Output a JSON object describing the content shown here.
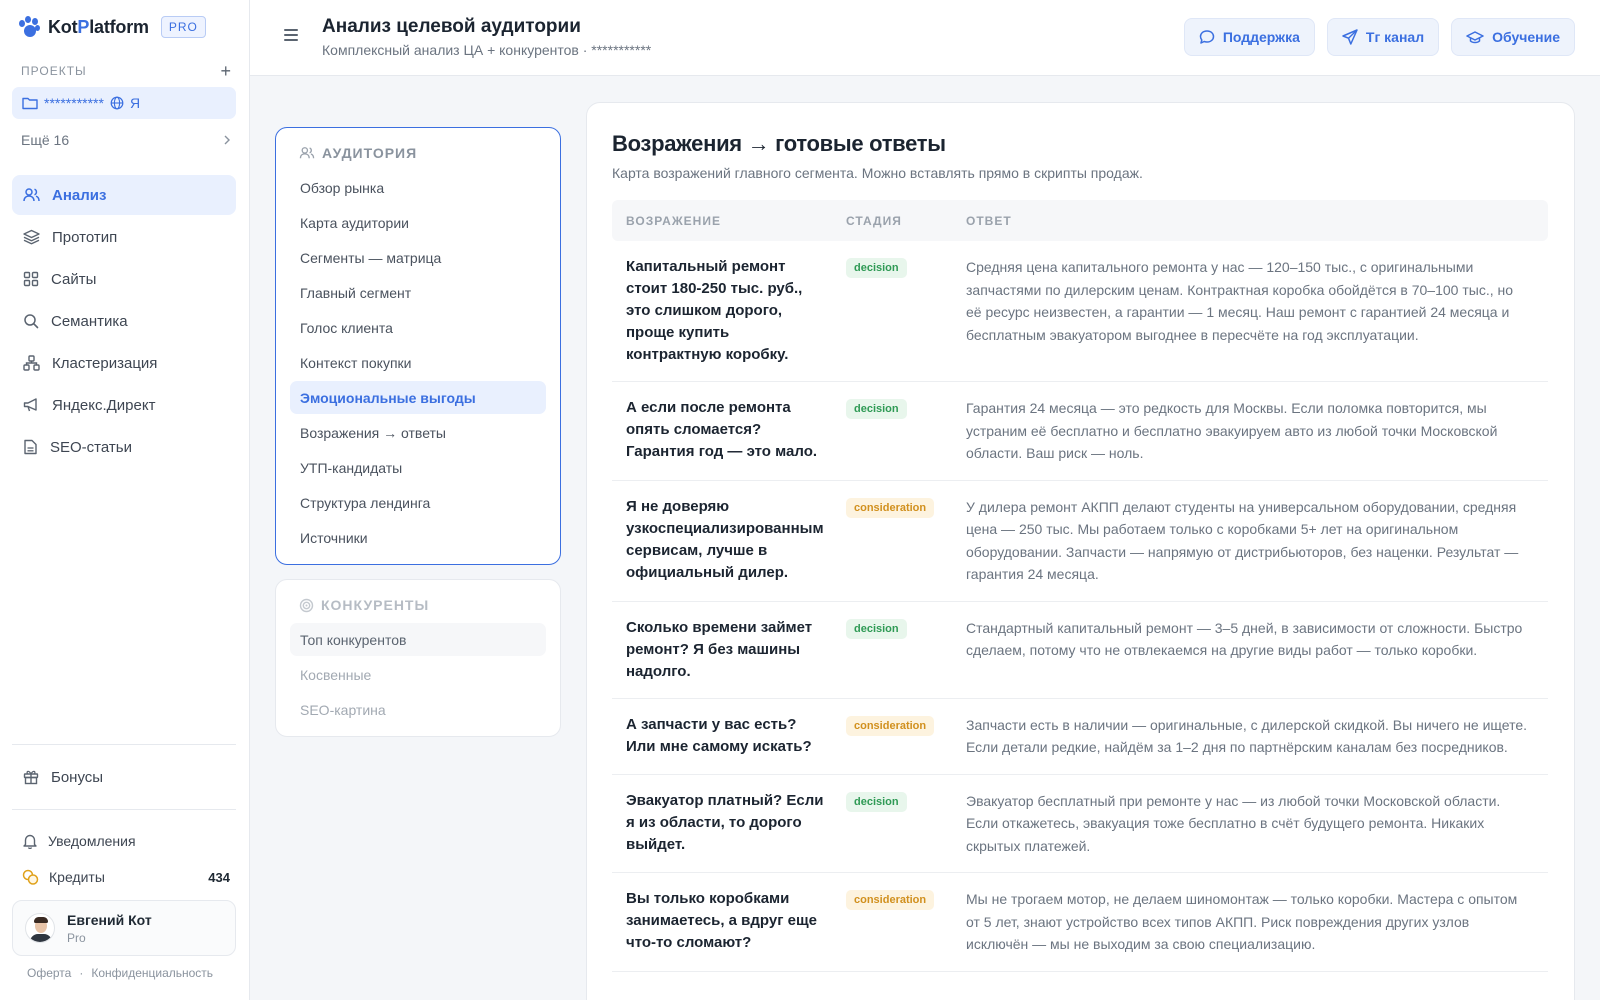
{
  "app": {
    "logo_prefix": "Kot",
    "logo_accent": "P",
    "logo_suffix": "latform",
    "plan_badge": "PRO"
  },
  "sidebar": {
    "projects_title": "ПРОЕКТЫ",
    "add_symbol": "+",
    "project": {
      "name": "***********",
      "owner": "Я"
    },
    "more_label": "Ещё 16",
    "nav": [
      {
        "label": "Анализ",
        "icon": "users-icon",
        "active": true
      },
      {
        "label": "Прототип",
        "icon": "layers-icon"
      },
      {
        "label": "Сайты",
        "icon": "grid-icon"
      },
      {
        "label": "Семантика",
        "icon": "search-icon"
      },
      {
        "label": "Кластеризация",
        "icon": "cluster-icon"
      },
      {
        "label": "Яндекс.Директ",
        "icon": "megaphone-icon"
      },
      {
        "label": "SEO-статьи",
        "icon": "document-icon"
      }
    ],
    "bonus_label": "Бонусы",
    "notifications_label": "Уведомления",
    "credits_label": "Кредиты",
    "credits_count": "434",
    "user": {
      "name": "Евгений Кот",
      "plan": "Pro"
    },
    "footer": {
      "offer": "Оферта",
      "separator": "·",
      "privacy": "Конфиденциальность"
    }
  },
  "header": {
    "title": "Анализ целевой аудитории",
    "subtitle": "Комплексный анализ ЦА + конкурентов · ***********",
    "buttons": {
      "support": "Поддержка",
      "telegram": "Тг канал",
      "learning": "Обучение"
    }
  },
  "audience_panel": {
    "title": "АУДИТОРИЯ",
    "items": [
      "Обзор рынка",
      "Карта аудитории",
      "Сегменты — матрица",
      "Главный сегмент",
      "Голос клиента",
      "Контекст покупки",
      "Эмоциональные выгоды",
      "Возражения → ответы",
      "УТП-кандидаты",
      "Структура лендинга",
      "Источники"
    ],
    "active_index": 6
  },
  "competitors_panel": {
    "title": "КОНКУРЕНТЫ",
    "items": [
      "Топ конкурентов",
      "Косвенные",
      "SEO-картина"
    ]
  },
  "main": {
    "title": "Возражения → готовые ответы",
    "description": "Карта возражений главного сегмента. Можно вставлять прямо в скрипты продаж.",
    "columns": {
      "objection": "ВОЗРАЖЕНИЕ",
      "stage": "СТАДИЯ",
      "answer": "ОТВЕТ"
    },
    "rows": [
      {
        "objection": "Капитальный ремонт стоит 180-250 тыс. руб., это слишком дорого, проще купить контрактную коробку.",
        "stage": "decision",
        "answer": "Средняя цена капитального ремонта у нас — 120–150 тыс., с оригинальными запчастями по дилерским ценам. Контрактная коробка обойдётся в 70–100 тыс., но её ресурс неизвестен, а гарантии — 1 месяц. Наш ремонт с гарантией 24 месяца и бесплатным эвакуатором выгоднее в пересчёте на год эксплуатации."
      },
      {
        "objection": "А если после ремонта опять сломается? Гарантия год — это мало.",
        "stage": "decision",
        "answer": "Гарантия 24 месяца — это редкость для Москвы. Если поломка повторится, мы устраним её бесплатно и бесплатно эвакуируем авто из любой точки Московской области. Ваш риск — ноль."
      },
      {
        "objection": "Я не доверяю узкоспециализированным сервисам, лучше в официальный дилер.",
        "stage": "consideration",
        "answer": "У дилера ремонт АКПП делают студенты на универсальном оборудовании, средняя цена — 250 тыс. Мы работаем только с коробками 5+ лет на оригинальном оборудовании. Запчасти — напрямую от дистрибьюторов, без наценки. Результат — гарантия 24 месяца."
      },
      {
        "objection": "Сколько времени займет ремонт? Я без машины надолго.",
        "stage": "decision",
        "answer": "Стандартный капитальный ремонт — 3–5 дней, в зависимости от сложности. Быстро сделаем, потому что не отвлекаемся на другие виды работ — только коробки."
      },
      {
        "objection": "А запчасти у вас есть? Или мне самому искать?",
        "stage": "consideration",
        "answer": "Запчасти есть в наличии — оригинальные, с дилерской скидкой. Вы ничего не ищете. Если детали редкие, найдём за 1–2 дня по партнёрским каналам без посредников."
      },
      {
        "objection": "Эвакуатор платный? Если я из области, то дорого выйдет.",
        "stage": "decision",
        "answer": "Эвакуатор бесплатный при ремонте у нас — из любой точки Московской области. Если откажетесь, эвакуация тоже бесплатно в счёт будущего ремонта. Никаких скрытых платежей."
      },
      {
        "objection": "Вы только коробками занимаетесь, а вдруг еще что-то сломают?",
        "stage": "consideration",
        "answer": "Мы не трогаем мотор, не делаем шиномонтаж — только коробки. Мастера с опытом от 5 лет, знают устройство всех типов АКПП. Риск повреждения других узлов исключён — мы не выходим за свою специализацию."
      }
    ]
  },
  "colors": {
    "accent": "#3b6fe0",
    "decision": "#2f9a55",
    "consideration": "#d1901e"
  }
}
